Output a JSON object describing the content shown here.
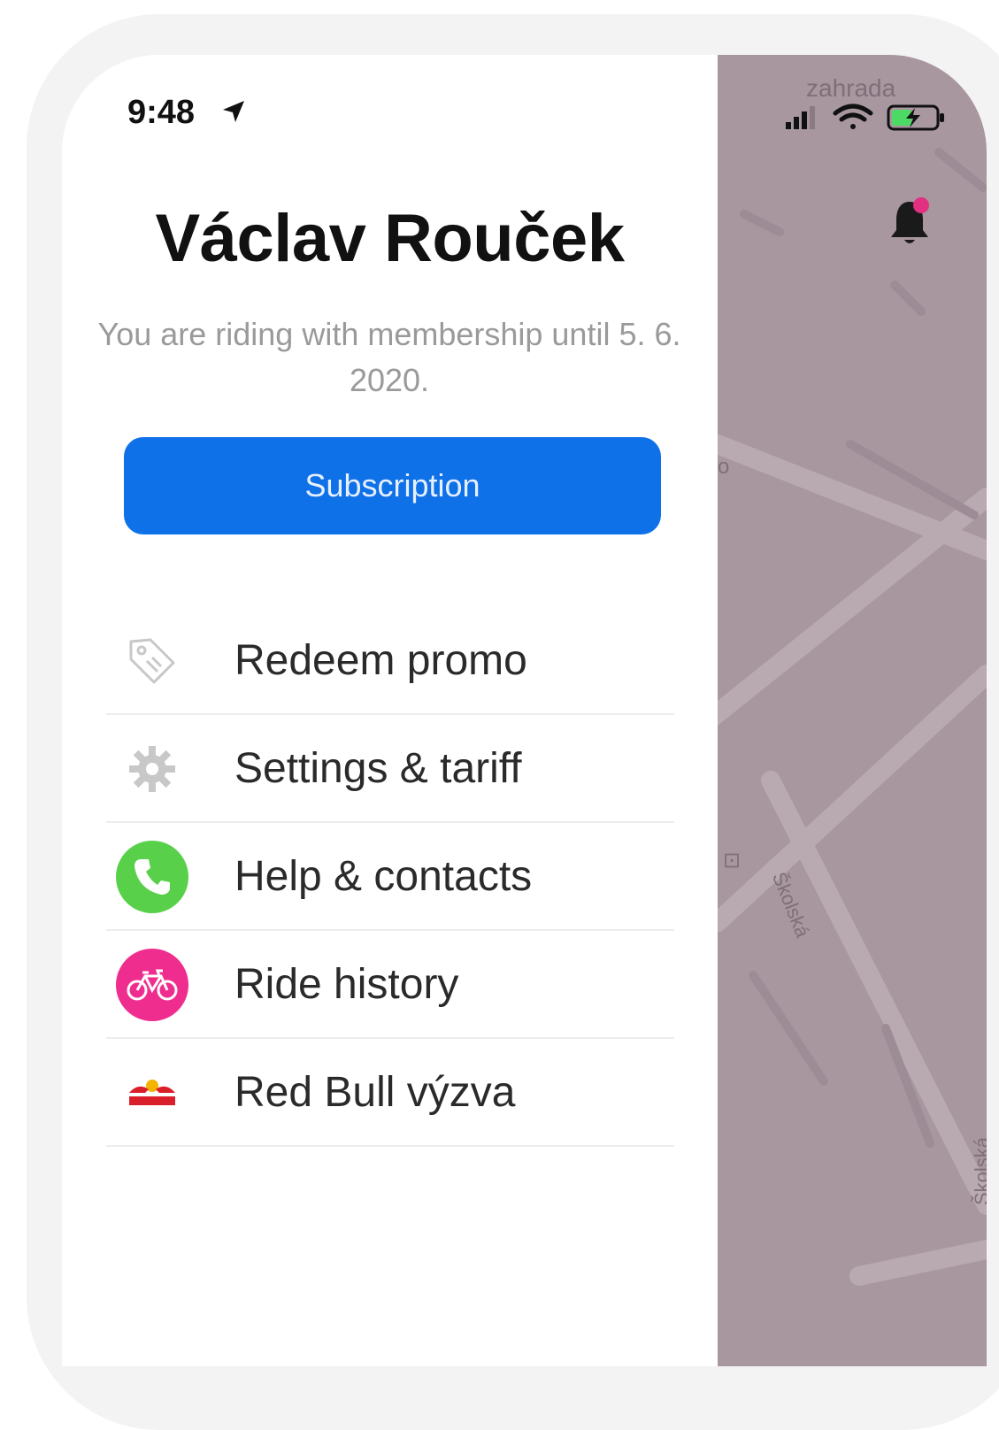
{
  "status_bar": {
    "time": "9:48"
  },
  "map": {
    "top_label": "zahrada",
    "street_label_1": "Školská",
    "street_label_2": "Školská",
    "edge_char": "o",
    "edge_box": "⊡",
    "background_color": "#a8979f"
  },
  "profile": {
    "name": "Václav Rouček",
    "membership": "You are riding with membership until 5. 6. 2020."
  },
  "subscription_button": {
    "label": "Subscription",
    "color": "#0f71e8"
  },
  "menu": {
    "items": [
      {
        "label": "Redeem promo",
        "icon": "tag-icon"
      },
      {
        "label": "Settings & tariff",
        "icon": "gear-icon"
      },
      {
        "label": "Help & contacts",
        "icon": "phone-icon"
      },
      {
        "label": "Ride history",
        "icon": "bike-icon"
      },
      {
        "label": "Red Bull výzva",
        "icon": "redbull-logo-icon"
      }
    ]
  },
  "colors": {
    "help_icon": "#59d04a",
    "ride_history_icon": "#ef2d8e",
    "notification_dot": "#e0307f"
  }
}
